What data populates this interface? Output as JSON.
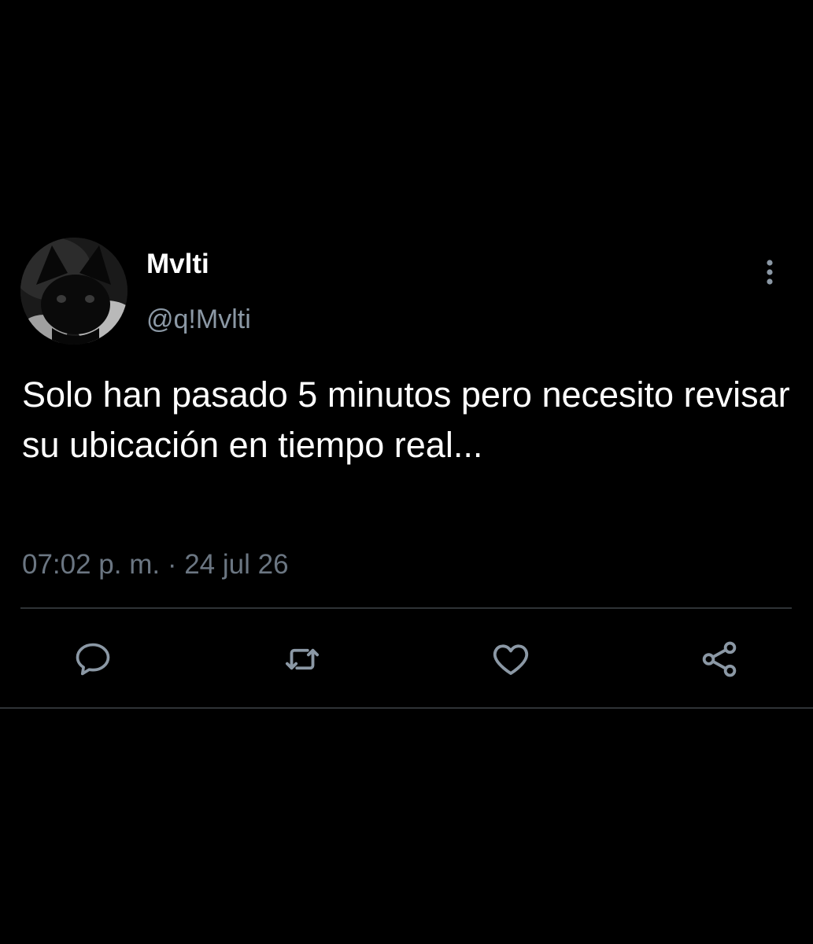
{
  "user": {
    "display_name": "Mvlti",
    "handle": "@q!Mvlti",
    "avatar_icon": "bat-avatar"
  },
  "tweet": {
    "text": "Solo han pasado 5 minutos pero necesito revisar su ubicación en tiempo real...",
    "timestamp": "07:02 p. m. · 24 jul 26"
  },
  "actions": [
    {
      "icon": "reply-icon"
    },
    {
      "icon": "retweet-icon"
    },
    {
      "icon": "like-icon"
    },
    {
      "icon": "share-icon"
    }
  ],
  "colors": {
    "background": "#000000",
    "text_primary": "#ffffff",
    "text_secondary": "#8b98a5",
    "icon": "#8b98a5",
    "divider": "#2f3336"
  }
}
